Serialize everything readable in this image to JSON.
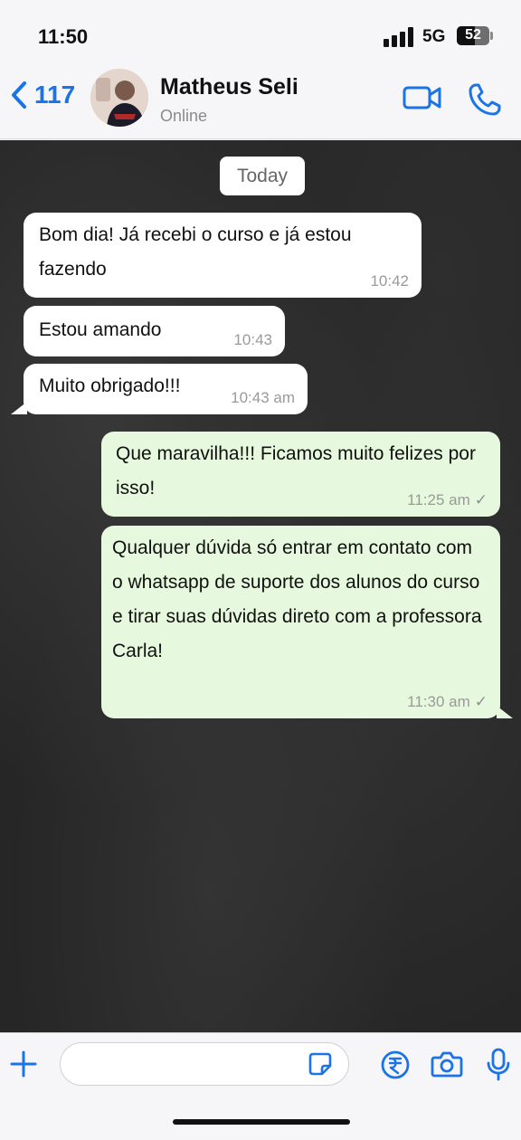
{
  "status_bar": {
    "time": "11:50",
    "network": "5G",
    "battery": "52"
  },
  "header": {
    "back_count": "117",
    "contact_name": "Matheus Seli",
    "contact_status": "Online",
    "icons": [
      "chevron-left-icon",
      "video-camera-icon",
      "phone-icon"
    ],
    "accent_color": "#1a73e8"
  },
  "chat": {
    "date_label": "Today",
    "messages": [
      {
        "direction": "incoming",
        "text": "Bom dia! Já recebi o curso e já estou fazendo",
        "time": "10:42"
      },
      {
        "direction": "incoming",
        "text": "Estou amando",
        "time": "10:43"
      },
      {
        "direction": "incoming",
        "text": "Muito obrigado!!!",
        "time": "10:43 am"
      },
      {
        "direction": "outgoing",
        "text": "Que maravilha!!! Ficamos muito felizes por isso!",
        "time": "11:25 am",
        "status": "sent"
      },
      {
        "direction": "outgoing",
        "text": "Qualquer dúvida só entrar em contato com o whatsapp de suporte dos alunos do curso e tirar suas dúvidas direto com a professora Carla!",
        "time": "11:30 am",
        "status": "sent"
      }
    ],
    "colors": {
      "incoming_bubble": "#ffffff",
      "outgoing_bubble": "#e6f8dd",
      "background": "#262626"
    }
  },
  "input_bar": {
    "message_value": "",
    "icons": [
      "plus-icon",
      "sticker-icon",
      "rupee-payment-icon",
      "camera-icon",
      "microphone-icon"
    ]
  }
}
